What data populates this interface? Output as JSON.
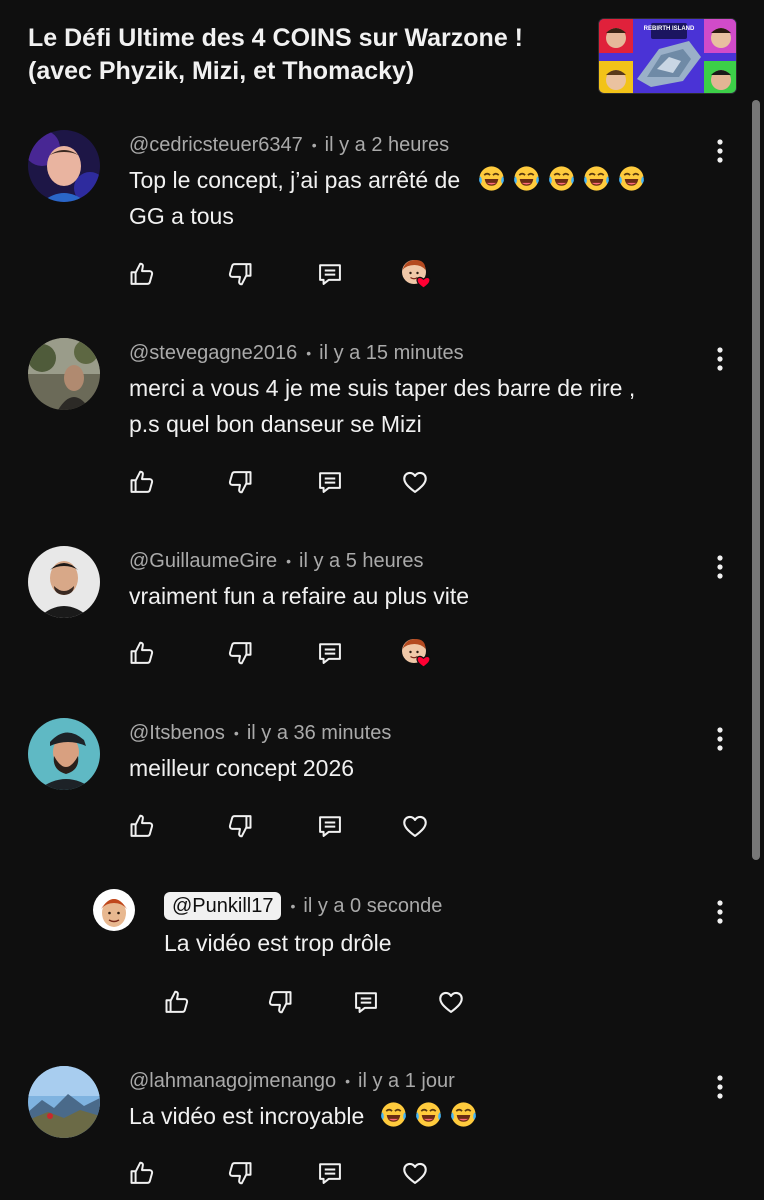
{
  "video": {
    "title_line1": "Le Défi Ultime des 4 COINS sur Warzone !",
    "title_line2": "(avec Phyzik, Mizi, et Thomacky)",
    "thumbnail_text": "REBIRTH ISLAND"
  },
  "comments": [
    {
      "author": "@cedricsteuer6347",
      "time": "il y a 2 heures",
      "text_line1": "Top le concept, j’ai pas arrêté de",
      "text_line2": "GG a tous",
      "emoji": "😂😂😂😂😂",
      "creator_heart": true
    },
    {
      "author": "@stevegagne2016",
      "time": "il y a 15 minutes",
      "text_line1": "merci a vous 4 je me suis taper des barre de rire ,",
      "text_line2": "p.s quel bon danseur se Mizi",
      "creator_heart": false
    },
    {
      "author": "@GuillaumeGire",
      "time": "il y a 5 heures",
      "text_line1": "vraiment fun a refaire au plus vite",
      "creator_heart": true
    },
    {
      "author": "@Itsbenos",
      "time": "il y a 36 minutes",
      "text_line1": "meilleur concept 2026",
      "creator_heart": false
    },
    {
      "author": "@Punkill17",
      "time": "il y a 0 seconde",
      "text_line1": "La vidéo est trop drôle",
      "is_reply": true,
      "creator_heart": false
    },
    {
      "author": "@lahmanagojmenango",
      "time": "il y a 1 jour",
      "text_line1": "La vidéo est incroyable",
      "emoji": "😂😂😂",
      "creator_heart": false
    }
  ],
  "meta_separator": "•",
  "icons": [
    "like-icon",
    "dislike-icon",
    "reply-icon",
    "heart-icon",
    "more-options-icon"
  ],
  "colors": {
    "background": "#0f0f0f",
    "text": "#f1f1f1",
    "meta": "#aaaaaa",
    "heart": "#ff0033"
  }
}
